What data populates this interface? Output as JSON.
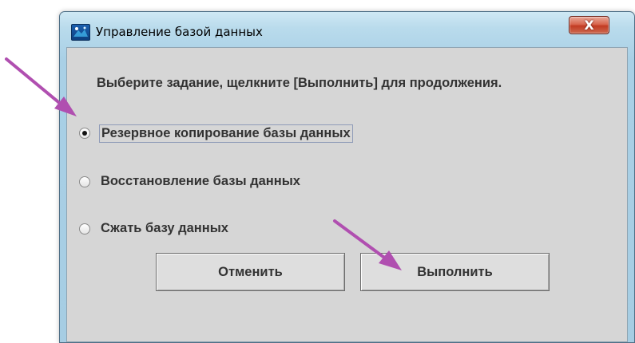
{
  "window": {
    "title": "Управление базой данных",
    "close_label": "X"
  },
  "dialog": {
    "instruction": "Выберите задание, щелкните [Выполнить] для продолжения.",
    "options": [
      {
        "label": "Резервное копирование базы данных",
        "selected": true
      },
      {
        "label": "Восстановление базы данных",
        "selected": false
      },
      {
        "label": "Сжать базу данных",
        "selected": false
      }
    ],
    "cancel_label": "Отменить",
    "execute_label": "Выполнить"
  },
  "annotations": {
    "arrow_color": "#b04fb0"
  }
}
